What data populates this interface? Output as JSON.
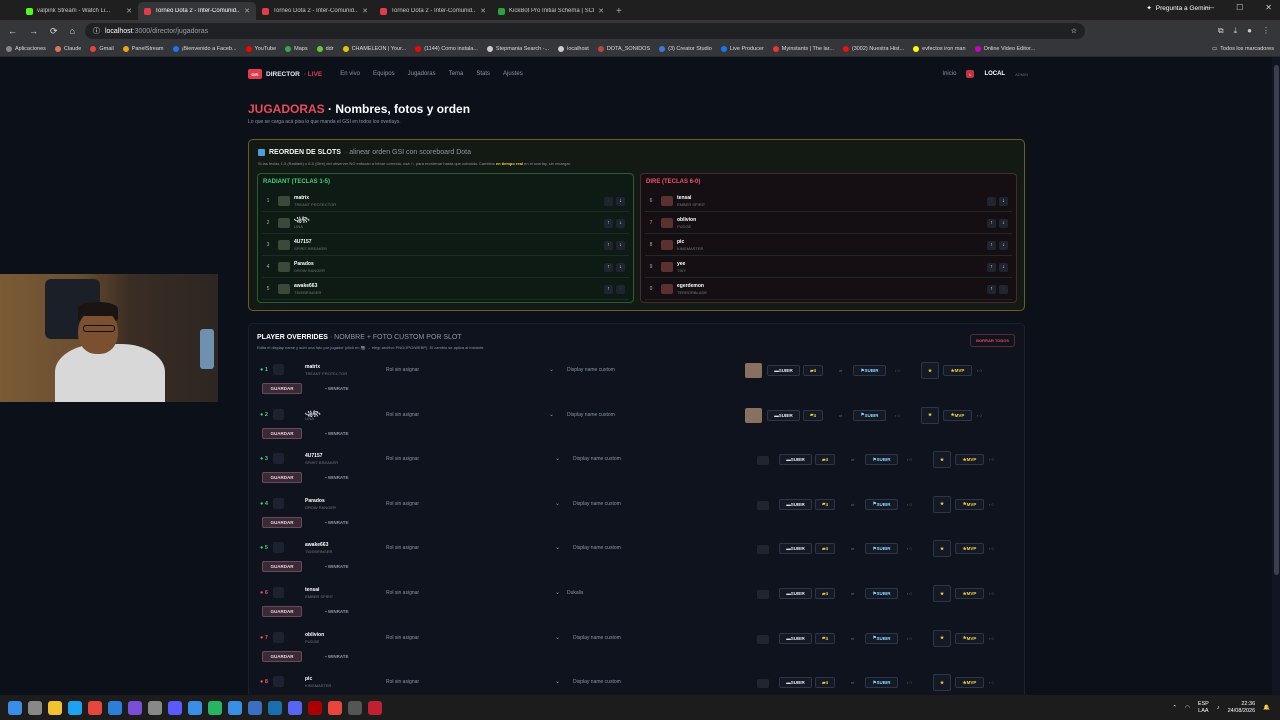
{
  "browser": {
    "tabs": [
      {
        "title": "valpink Stream - Watch Li...",
        "color": "#53fc18"
      },
      {
        "title": "Torneo Dota 2 - Inter-Comunid...",
        "color": "#e23b4b",
        "active": true
      },
      {
        "title": "Torneo Dota 2 - Inter-Comunid...",
        "color": "#e23b4b"
      },
      {
        "title": "Torneo Dota 2 - Inter-Comunid...",
        "color": "#e23b4b"
      },
      {
        "title": "KickBot Pro Initial Schema | SCL...",
        "color": "#2ea043"
      }
    ],
    "gemini": "Pregunta a Gemini",
    "url_host": "localhost",
    "url_path": ":3000/director/jugadoras",
    "bookmarks": [
      "Aplicaciones",
      "Claude",
      "Gmail",
      "PanelStream",
      "¡Bienvenido a Faceb...",
      "YouTube",
      "Maps",
      "ddr",
      "CHAMELEON | Your...",
      "(1144) Como instala...",
      "Stepmania Search -...",
      "localhost",
      "DOTA_SONIDOS",
      "(3) Creator Studio",
      "Live Producer",
      "Myinstants | The lar...",
      "(3002) Nuestra Hist...",
      "evfectos iron man",
      "Online Video Editor..."
    ],
    "all_bookmarks": "Todos los marcadores"
  },
  "app": {
    "logo": "DIRECTOR",
    "logo_live": "· LIVE",
    "menu": [
      "En vivo",
      "Equipos",
      "Jugadoras",
      "Tema",
      "Stats",
      "Ajustes"
    ],
    "inicio": "Inicio",
    "local": "LOCAL",
    "admin": "ADMIN",
    "title_red": "JUGADORAS",
    "title_rest": " · Nombres, fotos y orden",
    "subtitle": "Lo que se carga acá pisa lo que manda el GSI en todos los overlays."
  },
  "reorder": {
    "title": "REORDEN DE SLOTS",
    "title_dim": "· alinear orden GSI con scoreboard Dota",
    "desc": "Si las teclas 1-5 (Radiant) o 6-0 (Dire) del observer NO enfocan a héroe correcto, usá ↑↓ para reordenar hasta que coincida. Cambios",
    "desc_bold": "en tiempo real",
    "desc_end": "en el overlay, sin recargar.",
    "radiant_title": "RADIANT (TECLAS 1-5)",
    "dire_title": "DIRE (TECLAS 6-0)",
    "radiant": [
      {
        "n": "1",
        "name": "matrix",
        "hero": "TREANT PROTECTOR"
      },
      {
        "n": "2",
        "name": "꧁꧂",
        "hero": "LINA"
      },
      {
        "n": "3",
        "name": "4U7157",
        "hero": "SPIRIT BREAKER"
      },
      {
        "n": "4",
        "name": "Parados",
        "hero": "DROW RANGER"
      },
      {
        "n": "5",
        "name": "awake663",
        "hero": "TIDEBRINGER"
      }
    ],
    "dire": [
      {
        "n": "6",
        "name": "tensai",
        "hero": "EMBER SPIRIT"
      },
      {
        "n": "7",
        "name": "oblivion",
        "hero": "PUDGE"
      },
      {
        "n": "8",
        "name": "pic",
        "hero": "KINGMASTER"
      },
      {
        "n": "9",
        "name": "yee",
        "hero": "TINY"
      },
      {
        "n": "0",
        "name": "egerdemon",
        "hero": "TERRORBLADE"
      }
    ]
  },
  "overrides": {
    "title": "PLAYER OVERRIDES",
    "title_dim": "· NOMBRE + FOTO CUSTOM POR SLOT",
    "desc": "Editá el display name y subí una foto por jugador (click en 📷 → elegí archivo PNG/JPG/WEBP). El cambio se aplica al instante.",
    "clear": "BORRAR TODOS",
    "role_placeholder": "Rol sin asignar",
    "display_placeholder": "Display name custom",
    "subir": "SUBIR",
    "count": "4",
    "mvp": "MVP",
    "save": "GUARDAR",
    "winrate": "WINRATE",
    "rows": [
      {
        "n": "1",
        "name": "matrix",
        "hero": "TREANT PROTECTOR",
        "team": "radiant",
        "display": "Display name custom"
      },
      {
        "n": "2",
        "name": "꧁꧂",
        "hero": "LINA",
        "team": "radiant",
        "display": "Display name custom"
      },
      {
        "n": "3",
        "name": "4U7157",
        "hero": "SPIRIT BREAKER",
        "team": "radiant",
        "display": "Display name custom"
      },
      {
        "n": "4",
        "name": "Parados",
        "hero": "DROW RANGER",
        "team": "radiant",
        "display": "Display name custom"
      },
      {
        "n": "5",
        "name": "awake663",
        "hero": "TIDEBRINGER",
        "team": "radiant",
        "display": "Display name custom"
      },
      {
        "n": "6",
        "name": "tensai",
        "hero": "EMBER SPIRIT",
        "team": "dire",
        "display": "Dukalis"
      },
      {
        "n": "7",
        "name": "oblivion",
        "hero": "PUDGE",
        "team": "dire",
        "display": "Display name custom"
      },
      {
        "n": "8",
        "name": "pic",
        "hero": "KINGMASTER",
        "team": "dire",
        "display": "Display name custom"
      }
    ]
  },
  "taskbar": {
    "lang1": "ESP",
    "lang2": "LAA",
    "time": "22:36",
    "date": "24/08/2026"
  },
  "colors": {
    "accent": "#e23b4b",
    "radiant": "#42d17a",
    "dire": "#ef5365",
    "gold": "#f0d040"
  }
}
